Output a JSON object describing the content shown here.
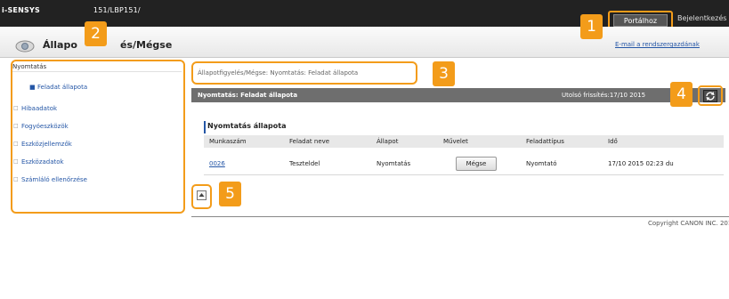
{
  "topbar": {
    "brand": "i-SENSYS",
    "model": "151/LBP151/",
    "portal_button": "Portálhoz",
    "login_link": "Bejelentkezés"
  },
  "header": {
    "title_part1": "Állapo",
    "title_part2": "és/Mégse",
    "email_link": "E-mail a rendszergazdának"
  },
  "sidebar": {
    "section_title": "Nyomtatás",
    "active_item": "Feladat állapota",
    "items": [
      "Hibaadatok",
      "Fogyóeszközök",
      "Eszközjellemzők",
      "Eszközadatok",
      "Számláló ellenőrzése"
    ]
  },
  "breadcrumb": "Állapotfigyelés/Mégse: Nyomtatás: Feladat állapota",
  "status": {
    "title": "Nyomtatás: Feladat állapota",
    "last_updated": "Utolsó frissítés:17/10 2015"
  },
  "job_section": {
    "heading": "Nyomtatás állapota",
    "columns": [
      "Munkaszám",
      "Feladat neve",
      "Állapot",
      "Művelet",
      "Feladattípus",
      "Idő"
    ],
    "rows": [
      {
        "job_number": "0026",
        "job_name": "Teszteldel",
        "status": "Nyomtatás",
        "action": "Mégse",
        "type": "Nyomtató",
        "time": "17/10 2015 02:23 du"
      }
    ]
  },
  "copyright": "Copyright CANON INC. 2015",
  "badges": [
    "1",
    "2",
    "3",
    "4",
    "5"
  ],
  "icons": {
    "page_icon": "monitor-eye-icon",
    "refresh": "refresh-icon",
    "back_to_top": "back-to-top-icon"
  },
  "colors": {
    "accent": "#f39c1a",
    "link": "#2456a6",
    "topbar": "#222222",
    "status_bar": "#6e6e6e"
  }
}
